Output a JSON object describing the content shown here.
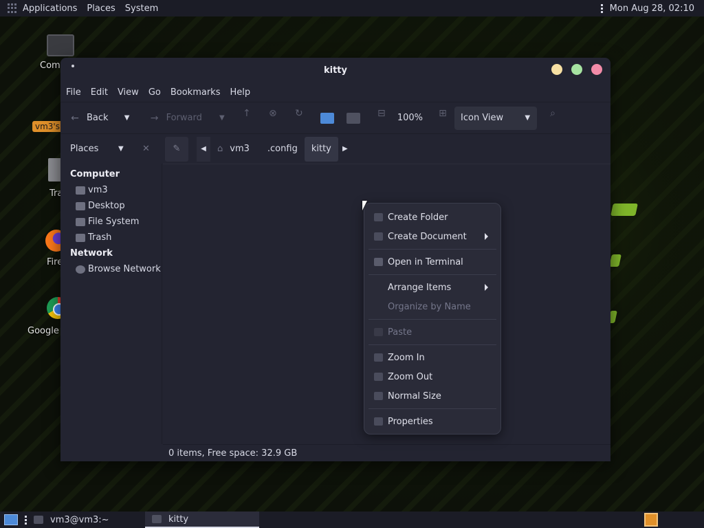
{
  "top_panel": {
    "menus": [
      "Applications",
      "Places",
      "System"
    ],
    "clock": "Mon Aug 28, 02:10"
  },
  "desktop": {
    "icons": {
      "computer": "Com",
      "home": "vm3's",
      "trash": "Tra",
      "firefox": "Fire",
      "chrome": "Google"
    }
  },
  "window": {
    "title": "kitty",
    "controls": {
      "minimize_color": "#f7e0a3",
      "maximize_color": "#a6e3a1",
      "close_color": "#f38ba8"
    },
    "menubar": [
      "File",
      "Edit",
      "View",
      "Go",
      "Bookmarks",
      "Help"
    ],
    "toolbar": {
      "back_label": "Back",
      "forward_label": "Forward",
      "zoom_level": "100%",
      "view_mode": "Icon View"
    },
    "places_label": "Places",
    "breadcrumb": [
      "vm3",
      ".config",
      "kitty"
    ],
    "sidebar": {
      "computer_label": "Computer",
      "computer_items": [
        "vm3",
        "Desktop",
        "File System",
        "Trash"
      ],
      "network_label": "Network",
      "network_items": [
        "Browse Network"
      ]
    },
    "status": "0 items, Free space: 32.9 GB"
  },
  "context_menu": {
    "items": [
      {
        "label": "Create Folder",
        "enabled": true
      },
      {
        "label": "Create Document",
        "enabled": true,
        "submenu": true
      },
      {
        "label": "Open in Terminal",
        "enabled": true
      },
      {
        "label": "Arrange Items",
        "enabled": true,
        "submenu": true
      },
      {
        "label": "Organize by Name",
        "enabled": false
      },
      {
        "label": "Paste",
        "enabled": false
      },
      {
        "label": "Zoom In",
        "enabled": true
      },
      {
        "label": "Zoom Out",
        "enabled": true
      },
      {
        "label": "Normal Size",
        "enabled": true
      },
      {
        "label": "Properties",
        "enabled": true
      }
    ]
  },
  "taskbar": {
    "tasks": [
      "vm3@vm3:~",
      "kitty"
    ],
    "accent_color": "#e0902a"
  }
}
